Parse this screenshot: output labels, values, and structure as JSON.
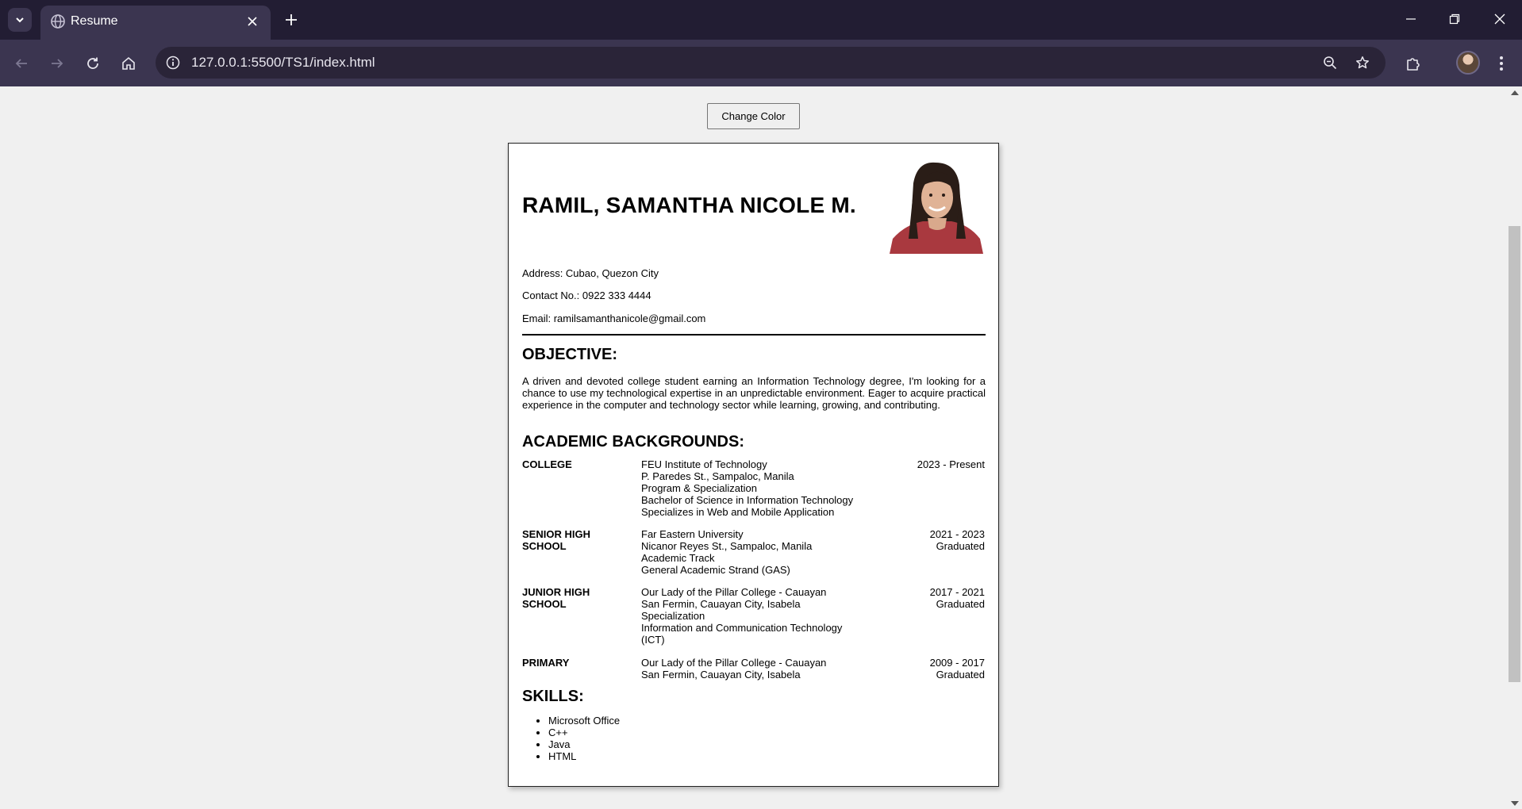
{
  "browser": {
    "tab_title": "Resume",
    "url": "127.0.0.1:5500/TS1/index.html"
  },
  "page": {
    "change_color_label": "Change Color"
  },
  "resume": {
    "name": "RAMIL, SAMANTHA NICOLE M.",
    "address": "Address: Cubao, Quezon City",
    "contact": "Contact No.: 0922 333 4444",
    "email": "Email: ramilsamanthanicole@gmail.com",
    "objective_heading": "OBJECTIVE:",
    "objective_text": "A driven and devoted college student earning an Information Technology degree, I'm looking for a chance to use my technological expertise in an unpredictable environment. Eager to acquire practical experience in the computer and technology sector while learning, growing, and contributing.",
    "academic_heading": "ACADEMIC BACKGROUNDS:",
    "education": [
      {
        "level": "COLLEGE",
        "details": [
          "FEU Institute of Technology",
          "P. Paredes St., Sampaloc, Manila",
          "Program & Specialization",
          "Bachelor of Science in Information Technology",
          "Specializes in Web and Mobile Application"
        ],
        "date": [
          "2023 - Present"
        ]
      },
      {
        "level": "SENIOR HIGH SCHOOL",
        "details": [
          "Far Eastern University",
          "Nicanor Reyes St., Sampaloc, Manila",
          "Academic Track",
          "General Academic Strand (GAS)"
        ],
        "date": [
          "2021 - 2023",
          "Graduated"
        ]
      },
      {
        "level": "JUNIOR HIGH SCHOOL",
        "details": [
          "Our Lady of the Pillar College - Cauayan",
          "San Fermin, Cauayan City, Isabela",
          "Specialization",
          "Information and Communication Technology (ICT)"
        ],
        "date": [
          "2017 - 2021",
          "Graduated"
        ]
      },
      {
        "level": "PRIMARY",
        "details": [
          "Our Lady of the Pillar College - Cauayan",
          "San Fermin, Cauayan City, Isabela"
        ],
        "date": [
          "2009 - 2017",
          "Graduated"
        ]
      }
    ],
    "skills_heading": "SKILLS:",
    "skills": [
      "Microsoft Office",
      "C++",
      "Java",
      "HTML"
    ]
  },
  "icons": {
    "tab_favicon": "globe-icon",
    "tab_close": "close-icon",
    "new_tab": "plus-icon",
    "back": "arrow-left-icon",
    "forward": "arrow-right-icon",
    "reload": "reload-icon",
    "home": "home-icon",
    "site_info": "info-icon",
    "zoom": "zoom-out-icon",
    "bookmark": "star-icon",
    "extensions": "puzzle-icon",
    "menu": "kebab-menu-icon"
  },
  "colors": {
    "chrome_dark": "#221d33",
    "chrome_toolbar": "#3b3550",
    "page_background": "#f0f0f0",
    "resume_background": "#ffffff"
  }
}
